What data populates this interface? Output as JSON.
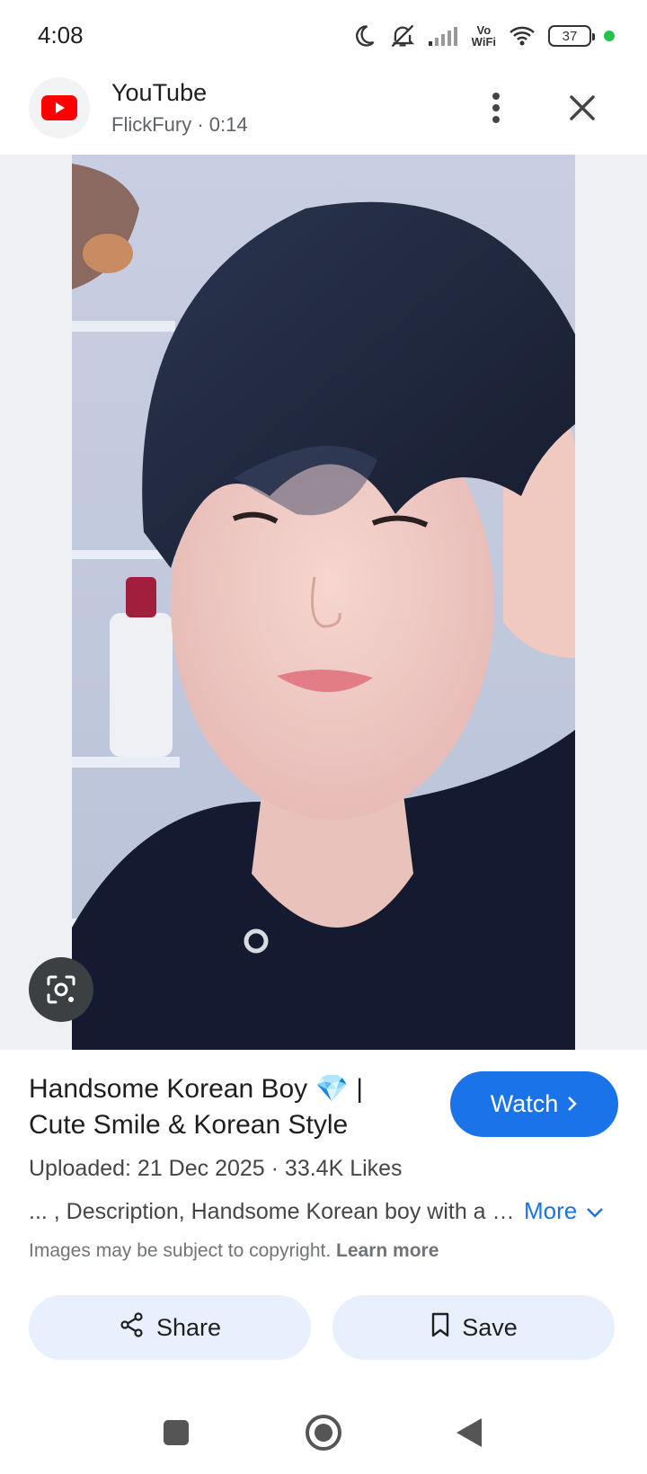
{
  "status_bar": {
    "time": "4:08",
    "battery": "37",
    "vowifi_line1": "Vo",
    "vowifi_line2": "WiFi",
    "icons": [
      "moon-icon",
      "bell-off-icon",
      "signal-icon",
      "vowifi-icon",
      "wifi-icon",
      "battery-icon",
      "green-dot"
    ]
  },
  "header": {
    "app_name": "YouTube",
    "subtitle": "FlickFury · 0:14",
    "icons": [
      "youtube-logo-icon",
      "more-vert-icon",
      "close-icon"
    ]
  },
  "image": {
    "alt": "Handsome Korean Boy",
    "lens_icon": "google-lens-icon"
  },
  "info": {
    "title": "Handsome Korean Boy 💎 | Cute Smile & Korean Style",
    "watch_label": "Watch",
    "meta": "Uploaded: 21 Dec 2025  ·  33.4K Likes",
    "description": "... , Description, Handsome Korean boy with a cute smile and Korean style",
    "more_label": "More",
    "copyright_text": "Images may be subject to copyright.",
    "learn_more": "Learn more"
  },
  "actions": {
    "share_label": "Share",
    "save_label": "Save"
  },
  "nav": {
    "icons": [
      "recents-square-icon",
      "home-circle-icon",
      "back-triangle-icon"
    ]
  },
  "colors": {
    "accent": "#1a73e8",
    "action_bg": "#e8f0fe",
    "youtube_red": "#ff0000",
    "image_bg": "#eef0f3"
  }
}
